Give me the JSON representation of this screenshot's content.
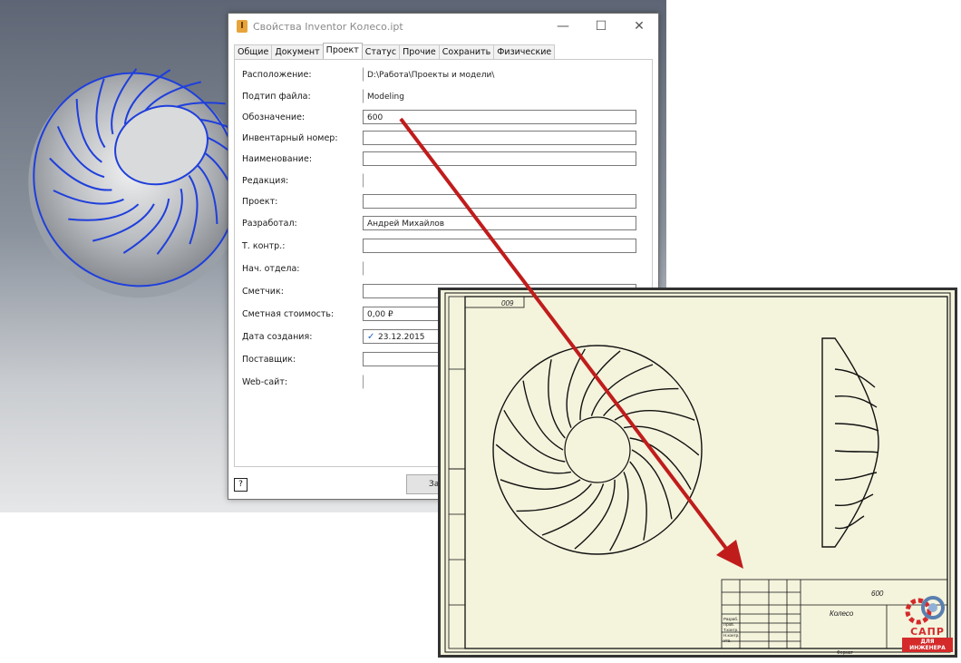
{
  "dialog": {
    "title": "Свойства Inventor Колесо.ipt",
    "icon_letter": "I",
    "minimize": "—",
    "maximize": "☐",
    "close": "✕",
    "tabs": [
      "Общие",
      "Документ",
      "Проект",
      "Статус",
      "Прочие",
      "Сохранить",
      "Физические"
    ],
    "active_tab": "Проект",
    "fields": [
      {
        "label": "Расположение:",
        "value": "D:\\Работа\\Проекты и модели\\",
        "boxed": false
      },
      {
        "label": "Подтип файла:",
        "value": "Modeling",
        "boxed": false
      },
      {
        "label": "Обозначение:",
        "value": "600",
        "boxed": true
      },
      {
        "label": "Инвентарный номер:",
        "value": "",
        "boxed": true
      },
      {
        "label": "Наименование:",
        "value": "",
        "boxed": true
      },
      {
        "label": "Редакция:",
        "value": "",
        "boxed": true
      },
      {
        "label": "Проект:",
        "value": "",
        "boxed": true
      },
      {
        "label": "Разработал:",
        "value": "Андрей Михайлов",
        "boxed": true
      },
      {
        "label": "Т. контр.:",
        "value": "",
        "boxed": true
      },
      {
        "label": "Нач. отдела:",
        "value": "",
        "boxed": true
      },
      {
        "label": "Сметчик:",
        "value": "",
        "boxed": true
      },
      {
        "label": "Сметная стоимость:",
        "value": "0,00 ₽",
        "boxed": true
      },
      {
        "label": "Дата создания:",
        "value": "23.12.2015",
        "boxed": true,
        "checked": true
      },
      {
        "label": "Поставщик:",
        "value": "",
        "boxed": true
      },
      {
        "label": "Web-сайт:",
        "value": "",
        "boxed": false
      }
    ],
    "help_label": "?",
    "close_button_label": "За"
  },
  "drawing": {
    "stamp_designation": "600",
    "corner_designation": "009",
    "part_name": "Колесо",
    "stamp_rows": [
      "Разраб.",
      "Пров.",
      "Т.контр.",
      "Н.контр.",
      "Утв."
    ],
    "format_label": "Формат"
  },
  "logo": {
    "name": "САПР",
    "subtitle": "ДЛЯ ИНЖЕНЕРА"
  },
  "colors": {
    "arrow": "#c01c1c",
    "blade_highlight": "#1f3fdc",
    "sheet": "#f4f3dc"
  }
}
